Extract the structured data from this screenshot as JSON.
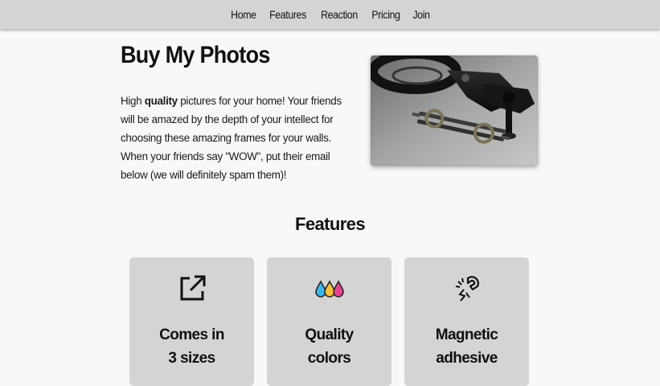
{
  "nav": {
    "items": [
      "Home",
      "Features",
      "Reaction",
      "Pricing",
      "Join"
    ]
  },
  "hero": {
    "title": "Buy My Photos",
    "text_before": "High ",
    "text_bold": "quality",
    "text_after": " pictures for your home! Your friends will be amazed by the depth of your intellect for choosing these amazing frames for your walls. When your friends say \"WOW\", put their email below (we will definitely spam them)!"
  },
  "features": {
    "title": "Features",
    "cards": [
      {
        "icon": "external-link-icon",
        "line1": "Comes in",
        "line2": "3 sizes"
      },
      {
        "icon": "ink-drops-icon",
        "line1": "Quality",
        "line2": "colors"
      },
      {
        "icon": "magnet-icon",
        "line1": "Magnetic",
        "line2": "adhesive"
      }
    ]
  },
  "colors": {
    "nav_bg": "#d4d4d4",
    "card_bg": "#d4d4d4",
    "page_bg": "#f8f8f8"
  }
}
